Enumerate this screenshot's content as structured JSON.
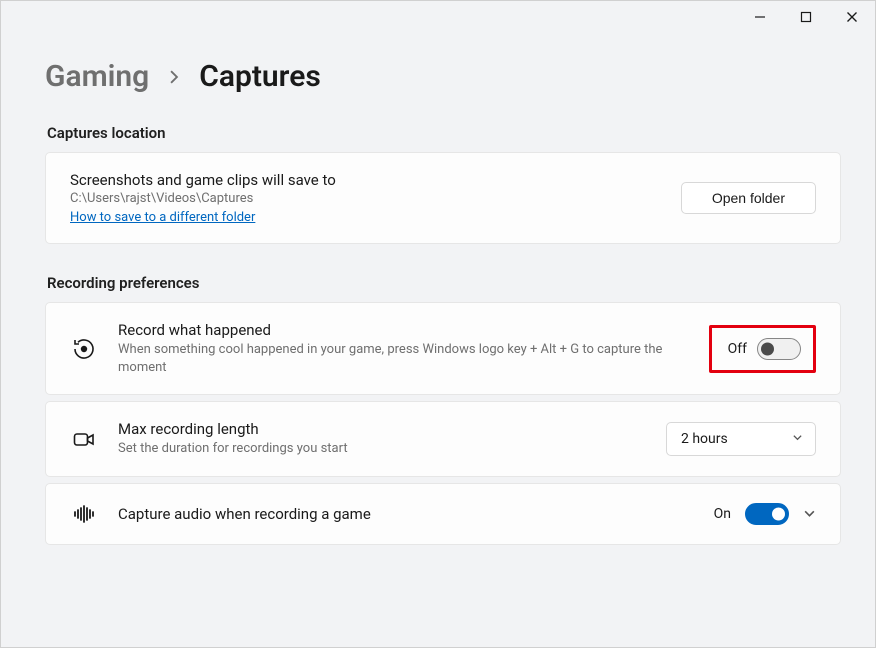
{
  "breadcrumb": {
    "parent": "Gaming",
    "current": "Captures"
  },
  "sections": {
    "location": {
      "title": "Captures location",
      "desc": "Screenshots and game clips will save to",
      "path": "C:\\Users\\rajst\\Videos\\Captures",
      "help_link": "How to save to a different folder",
      "open_button": "Open folder"
    },
    "recording": {
      "title": "Recording preferences",
      "record_happened": {
        "title": "Record what happened",
        "desc": "When something cool happened in your game, press Windows logo key + Alt + G to capture the moment",
        "state_label": "Off"
      },
      "max_length": {
        "title": "Max recording length",
        "desc": "Set the duration for recordings you start",
        "selected": "2 hours"
      },
      "capture_audio": {
        "title": "Capture audio when recording a game",
        "state_label": "On"
      }
    }
  }
}
